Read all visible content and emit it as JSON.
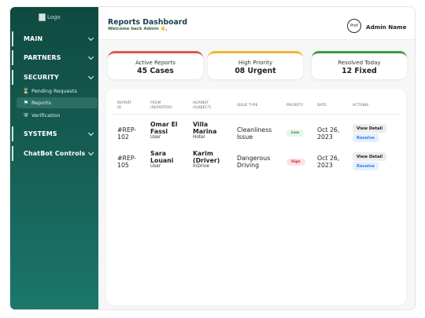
{
  "logo_alt": "Logo",
  "sidebar": {
    "sections": [
      {
        "label": "MAIN"
      },
      {
        "label": "PARTNERS"
      },
      {
        "label": "SECURITY"
      },
      {
        "label": "SYSTEMS"
      },
      {
        "label": "ChatBot Controls"
      }
    ],
    "security_items": [
      {
        "label": "Pending Requests",
        "icon": "hourglass-icon"
      },
      {
        "label": "Reports",
        "icon": "flag-icon",
        "active": true
      },
      {
        "label": "Verification",
        "icon": "shield-icon"
      }
    ]
  },
  "header": {
    "title": "Reports Dashboard",
    "welcome": "Welcome back Admin 👋,",
    "avatar_text": "Prof",
    "admin_name": "Admin Name"
  },
  "stats": [
    {
      "title": "Active Reports",
      "value": "45 Cases",
      "color": "#e0584a"
    },
    {
      "title": "High Priority",
      "value": "08 Urgent",
      "color": "#f1b731"
    },
    {
      "title": "Resolved Today",
      "value": "12 Fixed",
      "color": "#3d9a47"
    }
  ],
  "table": {
    "headers": [
      [
        "REPORT",
        "ID"
      ],
      [
        "FROM",
        "(REPORTER)"
      ],
      [
        "AGAINST",
        "(SUBJECT)"
      ],
      [
        "ISSUE TYPE"
      ],
      [
        "PRIORITY"
      ],
      [
        "DATE"
      ],
      [
        "ACTIONS"
      ]
    ],
    "rows": [
      {
        "id": [
          "#REP-",
          "102"
        ],
        "from": {
          "name": [
            "Omar El",
            "Fassi"
          ],
          "role": "User"
        },
        "against": {
          "name": [
            "Villa",
            "Marina"
          ],
          "role": "Hotel"
        },
        "issue": [
          "Cleanliness",
          "Issue"
        ],
        "priority": "Low",
        "date": [
          "Oct 26,",
          "2023"
        ]
      },
      {
        "id": [
          "#REP-",
          "105"
        ],
        "from": {
          "name": [
            "Sara",
            "Louani"
          ],
          "role": "User"
        },
        "against": {
          "name": [
            "Karim",
            "(Driver)"
          ],
          "role": "InDrive"
        },
        "issue": [
          "Dangerous",
          "Driving"
        ],
        "priority": "High",
        "date": [
          "Oct 26,",
          "2023"
        ]
      }
    ],
    "actions": {
      "view": "View Detail",
      "resolve": "Resolve"
    },
    "priority_colors": {
      "Low": {
        "bg": "#e5f5e6",
        "fg": "#2f8a3a"
      },
      "High": {
        "bg": "#fde2e4",
        "fg": "#d62839"
      }
    }
  }
}
